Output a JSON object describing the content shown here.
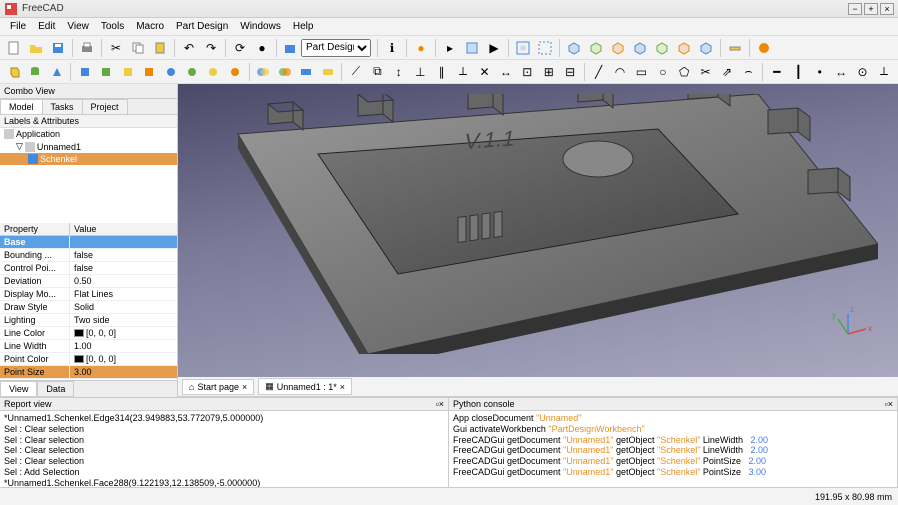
{
  "app": {
    "title": "FreeCAD"
  },
  "menu": [
    "File",
    "Edit",
    "View",
    "Tools",
    "Macro",
    "Part Design",
    "Windows",
    "Help"
  ],
  "workbench": {
    "selected": "Part Design"
  },
  "combo": {
    "title": "Combo View",
    "tabs": [
      "Model",
      "Tasks",
      "Project"
    ],
    "active_tab": 0,
    "tree_header": "Labels & Attributes",
    "tree": [
      {
        "label": "Application",
        "depth": 0,
        "sel": false
      },
      {
        "label": "Unnamed1",
        "depth": 1,
        "sel": false,
        "expander": "▽"
      },
      {
        "label": "Schenkel",
        "depth": 2,
        "sel": true
      }
    ],
    "prop_head": [
      "Property",
      "Value"
    ],
    "props": [
      {
        "name": "Base",
        "value": "",
        "cat": true
      },
      {
        "name": "Bounding ...",
        "value": "false"
      },
      {
        "name": "Control Poi...",
        "value": "false"
      },
      {
        "name": "Deviation",
        "value": "0.50"
      },
      {
        "name": "Display Mo...",
        "value": "Flat Lines"
      },
      {
        "name": "Draw Style",
        "value": "Solid"
      },
      {
        "name": "Lighting",
        "value": "Two side"
      },
      {
        "name": "Line Color",
        "value": "[0, 0, 0]",
        "swatch": true
      },
      {
        "name": "Line Width",
        "value": "1.00"
      },
      {
        "name": "Point Color",
        "value": "[0, 0, 0]",
        "swatch": true
      },
      {
        "name": "Point Size",
        "value": "3.00",
        "hl": true
      }
    ],
    "bottom_tabs": [
      "View",
      "Data"
    ],
    "bottom_active": 0
  },
  "viewport": {
    "tabs": [
      {
        "label": "Start page",
        "icon": "home"
      },
      {
        "label": "Unnamed1 : 1*",
        "icon": "doc"
      }
    ],
    "active": 1
  },
  "report": {
    "title": "Report view",
    "lines": [
      "*Unnamed1.Schenkel.Edge314(23.949883,53.772079,5.000000)",
      "Sel : Clear selection",
      "Sel : Clear selection",
      "Sel : Clear selection",
      "Sel : Clear selection",
      "Sel : Add Selection",
      "*Unnamed1.Schenkel.Face288(9.122193,12.138509,-5.000000)"
    ]
  },
  "console": {
    "title": "Python console",
    "lines": [
      {
        "parts": [
          [
            "",
            "App closeDocument "
          ],
          [
            "cmd",
            "\"Unnamed\""
          ]
        ]
      },
      {
        "parts": [
          [
            "",
            "Gui activateWorkbench "
          ],
          [
            "cmd",
            "\"PartDesignWorkbench\""
          ]
        ]
      },
      {
        "parts": [
          [
            "",
            "FreeCADGui getDocument "
          ],
          [
            "cmd",
            "\"Unnamed1\""
          ],
          [
            "",
            " getObject "
          ],
          [
            "cmd",
            "\"Schenkel\""
          ],
          [
            "",
            " LineWidth   "
          ],
          [
            "num",
            "2.00"
          ]
        ]
      },
      {
        "parts": [
          [
            "",
            "FreeCADGui getDocument "
          ],
          [
            "cmd",
            "\"Unnamed1\""
          ],
          [
            "",
            " getObject "
          ],
          [
            "cmd",
            "\"Schenkel\""
          ],
          [
            "",
            " LineWidth   "
          ],
          [
            "num",
            "2.00"
          ]
        ]
      },
      {
        "parts": [
          [
            "",
            "FreeCADGui getDocument "
          ],
          [
            "cmd",
            "\"Unnamed1\""
          ],
          [
            "",
            " getObject "
          ],
          [
            "cmd",
            "\"Schenkel\""
          ],
          [
            "",
            " PointSize   "
          ],
          [
            "num",
            "2.00"
          ]
        ]
      },
      {
        "parts": [
          [
            "",
            "FreeCADGui getDocument "
          ],
          [
            "cmd",
            "\"Unnamed1\""
          ],
          [
            "",
            " getObject "
          ],
          [
            "cmd",
            "\"Schenkel\""
          ],
          [
            "",
            " PointSize   "
          ],
          [
            "num",
            "3.00"
          ]
        ]
      }
    ]
  },
  "status": {
    "coords": "191.95 x 80.98 mm"
  },
  "icons": {
    "row1": [
      "new",
      "open",
      "save",
      "sep",
      "print",
      "sep",
      "cut",
      "copy",
      "paste",
      "sep",
      "undo",
      "redo",
      "sep",
      "reload",
      "stop",
      "sep",
      "workbench",
      "sep",
      "what",
      "sep",
      "dot",
      "sep",
      "next",
      "macro",
      "play",
      "sep",
      "iso1",
      "iso2",
      "sep",
      "cube1",
      "cube2",
      "cube3",
      "cube4",
      "cube5",
      "cube6",
      "cube7",
      "sep",
      "zoom",
      "sep",
      "sphere"
    ],
    "row2": [
      "box",
      "box2",
      "box3",
      "sep",
      "prim1",
      "prim2",
      "prim3",
      "prim4",
      "prim5",
      "prim6",
      "prim7",
      "prim8",
      "sep",
      "bool1",
      "bool2",
      "bool3",
      "bool4",
      "sep",
      "op1",
      "op2",
      "op3",
      "op4",
      "op5",
      "op6",
      "op7",
      "op8",
      "op9",
      "op10",
      "op11",
      "sep",
      "sk1",
      "sk2",
      "sk3",
      "sk4",
      "sk5",
      "sk6",
      "sk7",
      "sk8",
      "sep",
      "c1",
      "c2",
      "c3",
      "c4",
      "c5",
      "c6"
    ]
  }
}
